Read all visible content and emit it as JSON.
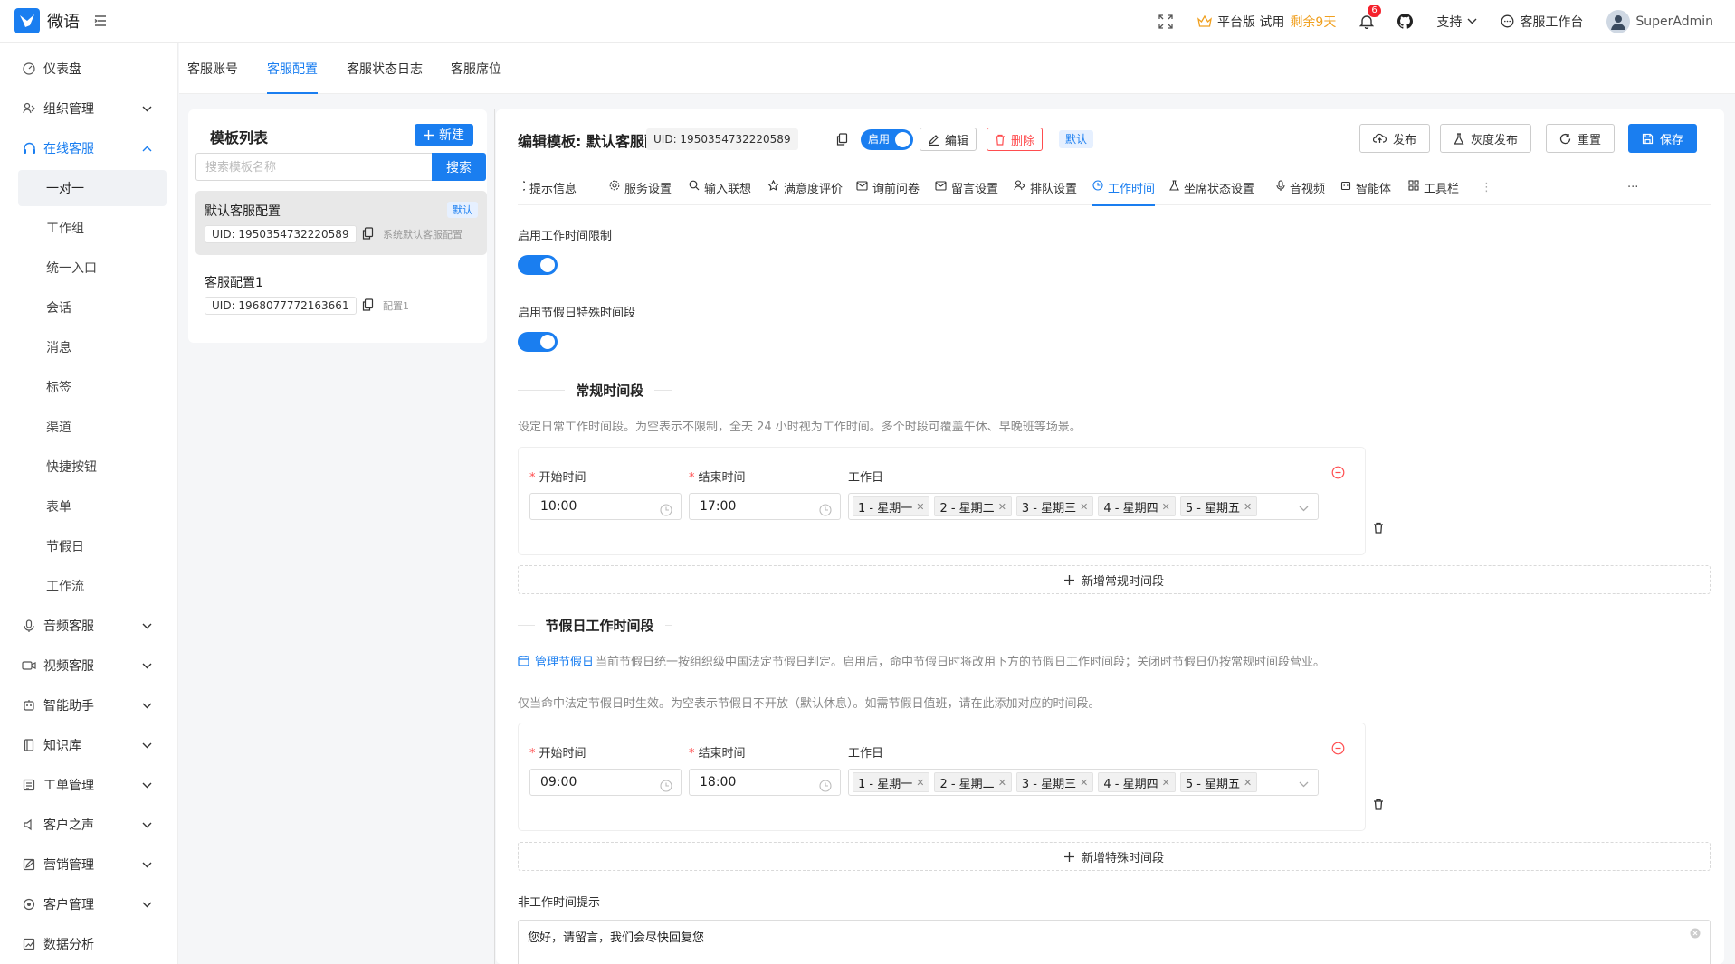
{
  "app": {
    "name": "微语"
  },
  "topbar": {
    "plan": "平台版 试用",
    "trial_left": "剩余9天",
    "notif_count": "6",
    "support": "支持",
    "workbench": "客服工作台",
    "user": "SuperAdmin"
  },
  "sidebar": {
    "items": [
      {
        "label": "仪表盘"
      },
      {
        "label": "组织管理"
      },
      {
        "label": "在线客服"
      },
      {
        "label": "音频客服"
      },
      {
        "label": "视频客服"
      },
      {
        "label": "智能助手"
      },
      {
        "label": "知识库"
      },
      {
        "label": "工单管理"
      },
      {
        "label": "客户之声"
      },
      {
        "label": "营销管理"
      },
      {
        "label": "客户管理"
      },
      {
        "label": "数据分析"
      }
    ],
    "sub": [
      "一对一",
      "工作组",
      "统一入口",
      "会话",
      "消息",
      "标签",
      "渠道",
      "快捷按钮",
      "表单",
      "节假日",
      "工作流"
    ]
  },
  "tabs": [
    "客服账号",
    "客服配置",
    "客服状态日志",
    "客服席位"
  ],
  "template_list": {
    "title": "模板列表",
    "new_label": "新建",
    "search_placeholder": "搜索模板名称",
    "search_label": "搜索",
    "items": [
      {
        "name": "默认客服配置",
        "uid": "UID: 1950354732220589",
        "desc": "系统默认客服配置",
        "badge": "默认"
      },
      {
        "name": "客服配置1",
        "uid": "UID: 1968077772163661",
        "desc": "配置1"
      }
    ]
  },
  "editor": {
    "title": "编辑模板: 默认客服配置",
    "uid": "UID: 1950354732220589",
    "enabled_label": "启用",
    "edit_label": "编辑",
    "delete_label": "删除",
    "default_label": "默认",
    "publish": "发布",
    "gray_publish": "灰度发布",
    "reset": "重置",
    "save": "保存",
    "subtabs": [
      "提示信息",
      "服务设置",
      "输入联想",
      "满意度评价",
      "询前问卷",
      "留言设置",
      "排队设置",
      "工作时间",
      "坐席状态设置",
      "音视频",
      "智能体",
      "工具栏"
    ],
    "more": "···"
  },
  "worktime": {
    "enable_limit_label": "启用工作时间限制",
    "enable_holiday_label": "启用节假日特殊时间段",
    "regular_title": "常规时间段",
    "regular_help": "设定日常工作时间段。为空表示不限制，全天 24 小时视为工作时间。多个时段可覆盖午休、早晚班等场景。",
    "start_label": "开始时间",
    "end_label": "结束时间",
    "days_label": "工作日",
    "regular_slot": {
      "start": "10:00",
      "end": "17:00"
    },
    "days": [
      "1 - 星期一",
      "2 - 星期二",
      "3 - 星期三",
      "4 - 星期四",
      "5 - 星期五"
    ],
    "add_regular": "新增常规时间段",
    "holiday_title": "节假日工作时间段",
    "manage_holiday": "管理节假日",
    "holiday_help1": "当前节假日统一按组织级中国法定节假日判定。启用后，命中节假日时将改用下方的节假日工作时间段；关闭时节假日仍按常规时间段营业。",
    "holiday_help2": "仅当命中法定节假日时生效。为空表示节假日不开放（默认休息）。如需节假日值班，请在此添加对应的时间段。",
    "holiday_slot": {
      "start": "09:00",
      "end": "18:00"
    },
    "add_holiday": "新增特殊时间段",
    "offhours_label": "非工作时间提示",
    "offhours_value": "您好，请留言，我们会尽快回复您"
  },
  "colors": {
    "accent": "#1a7ef0",
    "danger": "#ff4d4f"
  }
}
